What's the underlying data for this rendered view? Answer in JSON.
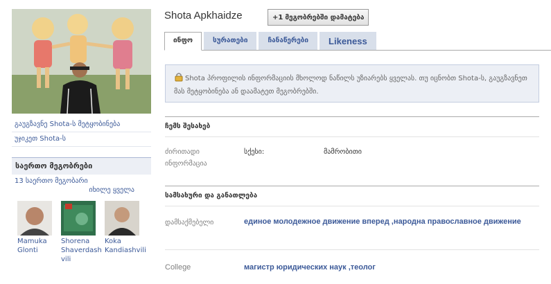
{
  "profile": {
    "name": "Shota Apkhaidze",
    "add_friend_label": "მეგობრებში დამატება",
    "add_friend_icon": "+1"
  },
  "left": {
    "links": [
      "გაუგზავნე Shota-ს მეტყობინება",
      "უჯიკეთ Shota-ს"
    ],
    "mutual_title": "საერთო მეგობრები",
    "mutual_count": "13 საერთო მეგობარი",
    "see_all": "იხილე ყველა",
    "friends": [
      {
        "name": "Mamuka Glonti"
      },
      {
        "name": "Shorena Shaverdashvili"
      },
      {
        "name": "Koka Kandiashvili"
      }
    ]
  },
  "tabs": [
    {
      "label": "ინფო",
      "active": true
    },
    {
      "label": "სურათები",
      "active": false
    },
    {
      "label": "ჩანაწერები",
      "active": false
    },
    {
      "label": "Likeness",
      "active": false
    }
  ],
  "notice": {
    "text": "Shota პროფილის ინფორმაციის მხოლოდ ნაწილს უზიარებს ყველას. თუ იცნობთ Shota-ს, გაუგზავნეთ მას მეტყობინება ან დაამატეთ მეგობრებში."
  },
  "about": {
    "title": "ჩემს შესახებ",
    "basic_label": "ძირითადი ინფორმაცია",
    "sex_label": "სქესი:",
    "sex_value": "მამრობითი"
  },
  "work": {
    "title": "სამსახური და განათლება",
    "employer_label": "დამსაქმებელი",
    "employer_value": "единое молодежное движение вперед ,народна православное движение",
    "college_label": "College",
    "college_value": "магистр юридических наук ,теолог"
  },
  "colors": {
    "link": "#3b5998",
    "tab_bg": "#d8dfea",
    "notice_bg": "#eceff5"
  }
}
